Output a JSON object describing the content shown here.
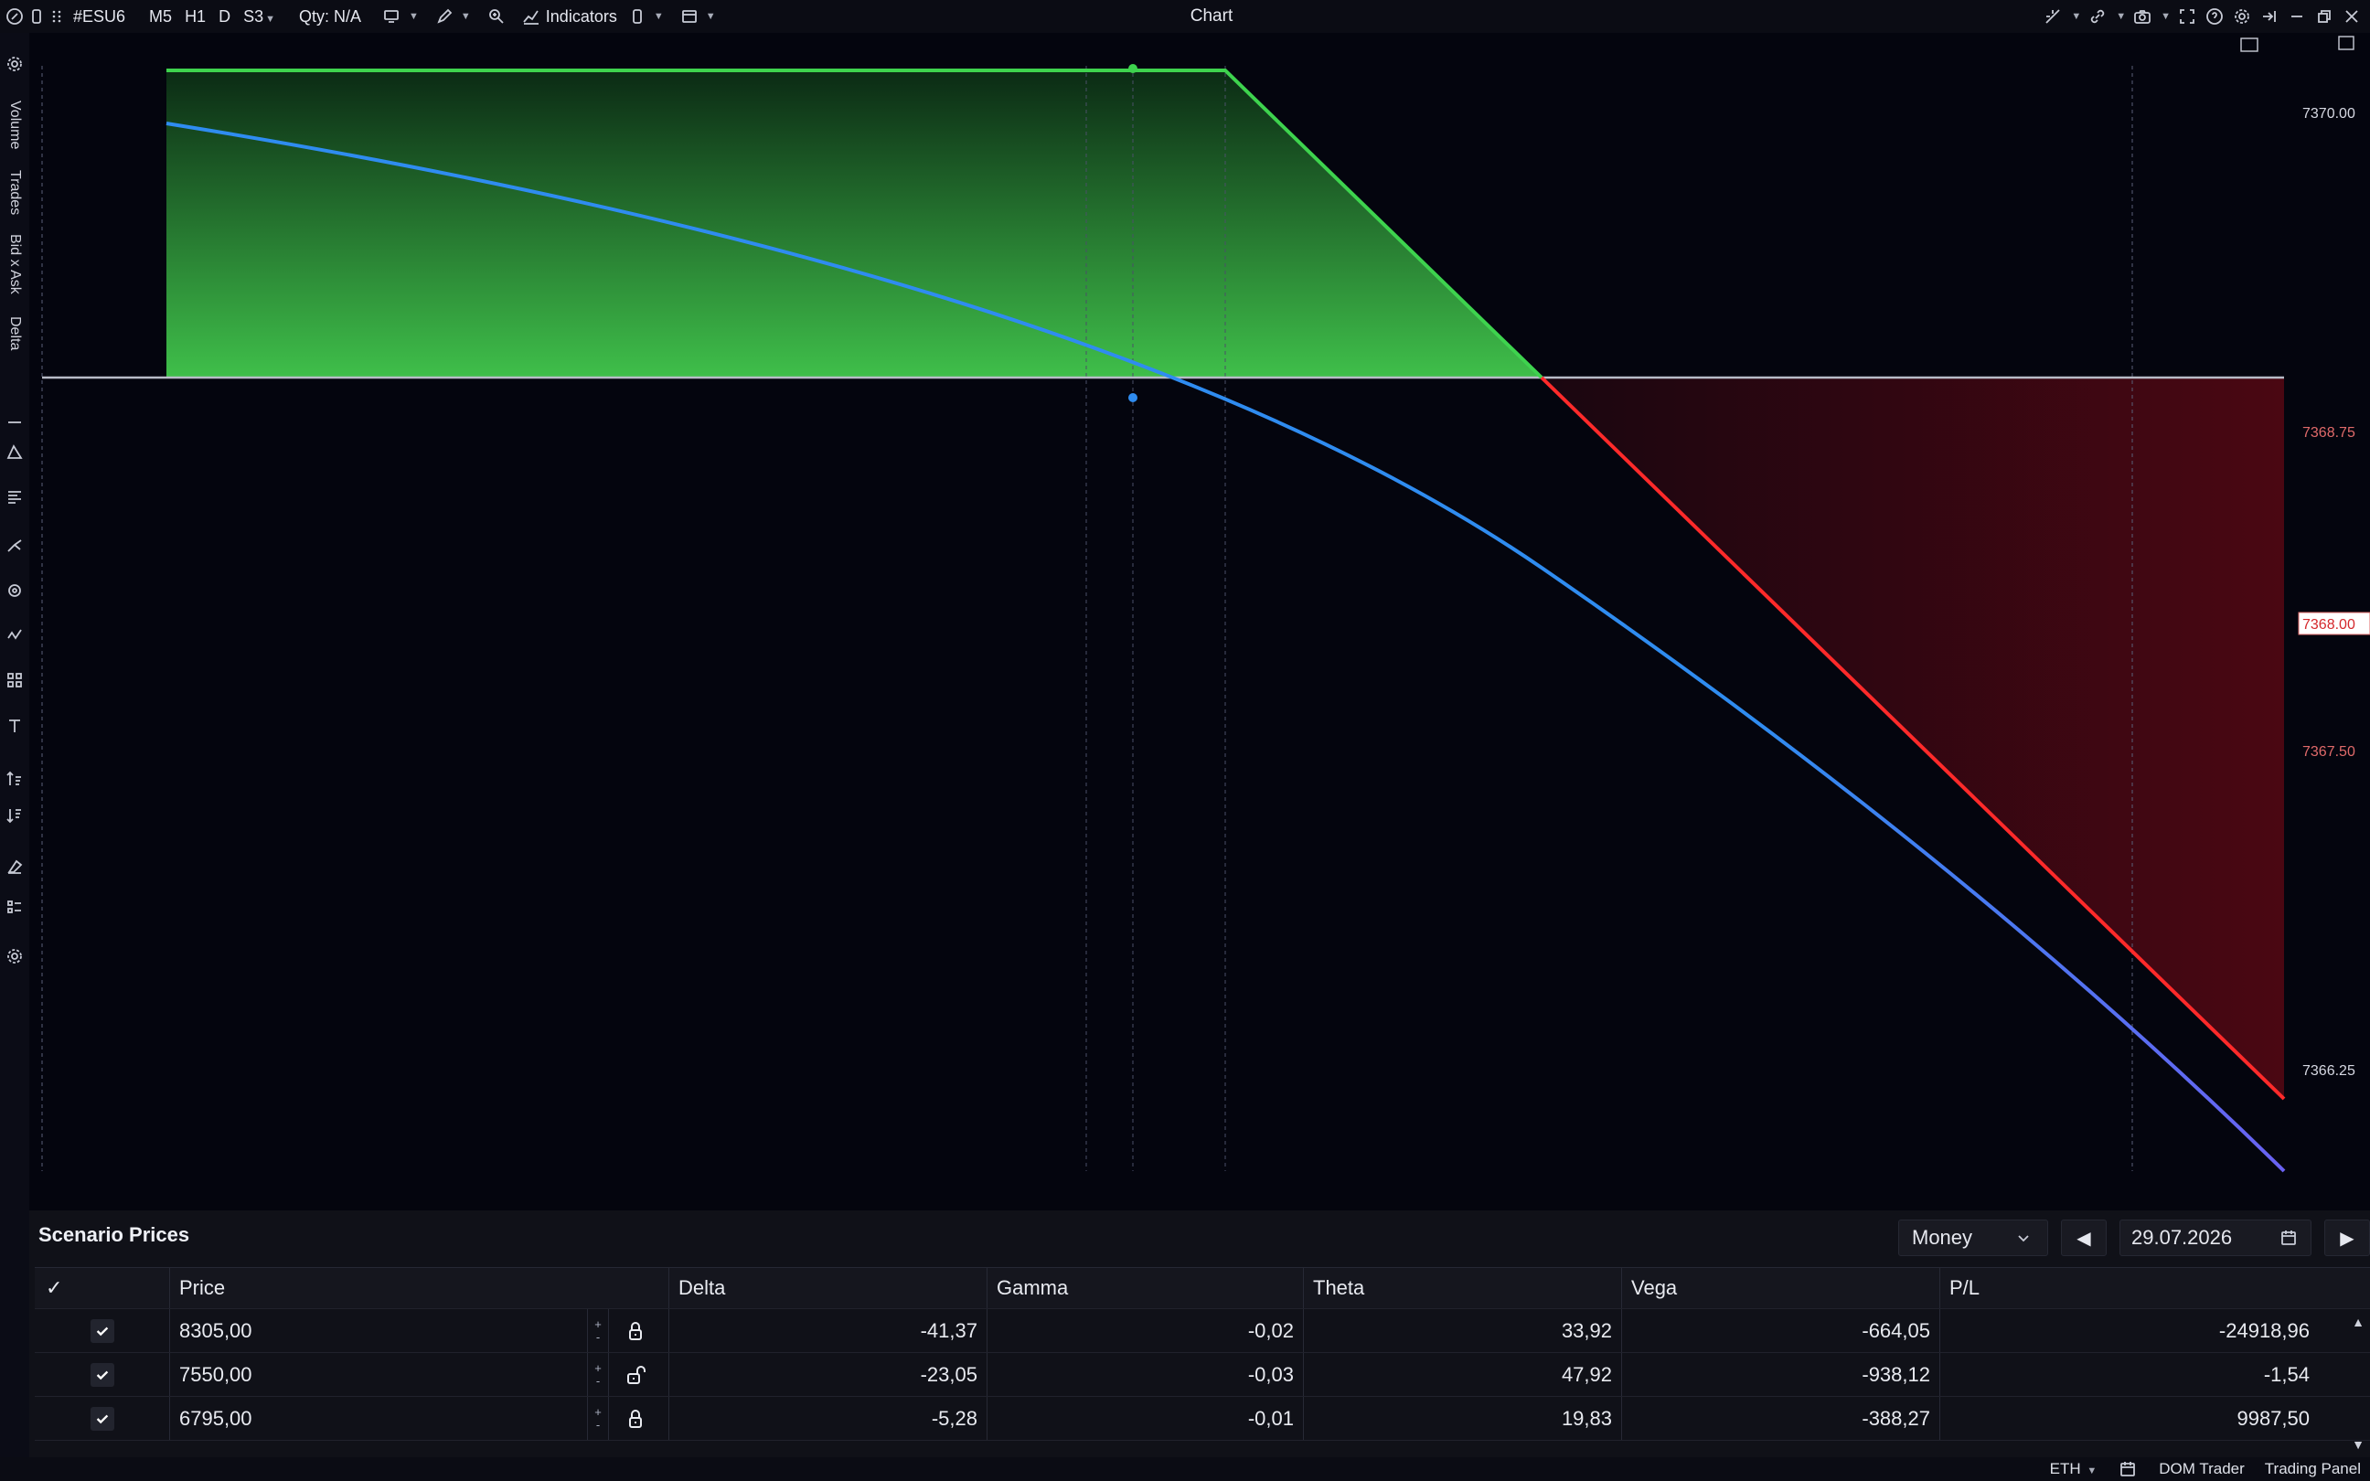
{
  "toolbar": {
    "symbol": "#ESU6",
    "timeframes": [
      "M5",
      "H1",
      "D",
      "S3"
    ],
    "qty": "Qty: N/A",
    "indicators_label": "Indicators",
    "title": "Chart"
  },
  "left_panel": {
    "vertical_labels": [
      "Volume",
      "Trades",
      "Bid x Ask",
      "Delta"
    ]
  },
  "chart": {
    "price_labels": [
      "7370.00",
      "7368.75",
      "7368.00",
      "7367.50",
      "7366.25"
    ],
    "current_price_label": "7368.00",
    "colors": {
      "background": "#04050e",
      "profit_fill": "#3fbf4a",
      "profit_line": "#3ed34e",
      "loss_line": "#ff2a2a",
      "loss_fill": "#5a0a14",
      "theoretical_curve": "#2f8cf0",
      "zero_line": "#b8bcc8"
    }
  },
  "chart_data": {
    "type": "line",
    "title": "",
    "series": [
      {
        "name": "",
        "kind": "expiration-payoff",
        "color": "#3ed34e"
      },
      {
        "name": "",
        "kind": "theoretical-pl",
        "color": "#2f8cf0"
      }
    ],
    "y_tick_labels": [
      "7370.00",
      "7368.75",
      "7368.00",
      "7367.50",
      "7366.25"
    ],
    "highlighted_y_label": "7368.00",
    "grid": false
  },
  "panel": {
    "title": "Scenario Prices",
    "view_select": "Money",
    "date": "29.07.2026",
    "columns": [
      "✓",
      "Price",
      "Delta",
      "Gamma",
      "Theta",
      "Vega",
      "P/L"
    ],
    "rows": [
      {
        "checked": true,
        "price": "8305,00",
        "locked": true,
        "delta": "-41,37",
        "gamma": "-0,02",
        "theta": "33,92",
        "vega": "-664,05",
        "pl": "-24918,96"
      },
      {
        "checked": true,
        "price": "7550,00",
        "locked": false,
        "delta": "-23,05",
        "gamma": "-0,03",
        "theta": "47,92",
        "vega": "-938,12",
        "pl": "-1,54"
      },
      {
        "checked": true,
        "price": "6795,00",
        "locked": true,
        "delta": "-5,28",
        "gamma": "-0,01",
        "theta": "19,83",
        "vega": "-388,27",
        "pl": "9987,50"
      }
    ]
  },
  "statusbar": {
    "session": "ETH",
    "dom_trader": "DOM Trader",
    "trading_panel": "Trading Panel"
  }
}
